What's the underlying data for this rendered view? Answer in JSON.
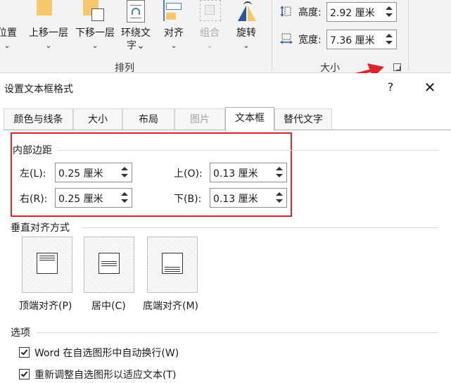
{
  "ribbon": {
    "buttons": [
      {
        "label": "位置",
        "chevron": "⌄"
      },
      {
        "label": "上移一层",
        "chevron": "⌄"
      },
      {
        "label": "下移一层",
        "chevron": "⌄"
      },
      {
        "label": "环绕文",
        "label2": "字⌄"
      },
      {
        "label": "对齐",
        "chevron": "⌄"
      },
      {
        "label": "组合",
        "chevron": "⌄"
      },
      {
        "label": "旋转",
        "chevron": "⌄"
      }
    ],
    "group_arrange": "排列",
    "group_size": "大小",
    "height_label": "高度:",
    "height_value": "2.92 厘米",
    "width_label": "宽度:",
    "width_value": "7.36 厘米"
  },
  "dialog": {
    "title": "设置文本框格式",
    "help": "?",
    "close": "✕",
    "tabs": [
      "颜色与线条",
      "大小",
      "布局",
      "图片",
      "文本框",
      "替代文字"
    ],
    "active_tab": "文本框",
    "disabled_tab": "图片",
    "internal_margin": {
      "heading": "内部边距",
      "left_label": "左(L):",
      "left_value": "0.25 厘米",
      "top_label": "上(O):",
      "top_value": "0.13 厘米",
      "right_label": "右(R):",
      "right_value": "0.25 厘米",
      "bottom_label": "下(B):",
      "bottom_value": "0.13 厘米"
    },
    "vertical_alignment": {
      "heading": "垂直对齐方式",
      "top_label": "顶端对齐(P)",
      "center_label": "居中(C)",
      "bottom_label": "底端对齐(M)"
    },
    "options": {
      "heading": "选项",
      "wrap_label": "Word 在自选图形中自动换行(W)",
      "wrap_checked": true,
      "resize_label": "重新调整自选图形以适应文本(T)",
      "resize_checked": true
    }
  },
  "colors": {
    "annotation_red": "#e0252a",
    "accent_blue": "#2b579a",
    "icon_yellow": "#f5c86a"
  }
}
